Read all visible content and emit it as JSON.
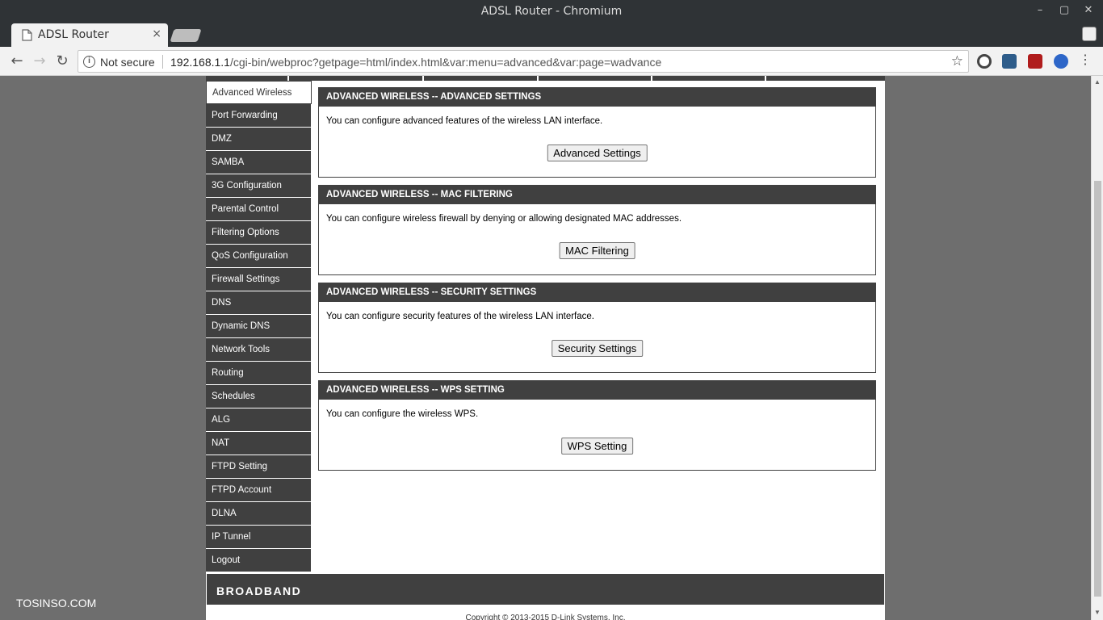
{
  "window": {
    "title": "ADSL Router - Chromium",
    "minimize": "–",
    "maximize": "▢",
    "close": "✕"
  },
  "tab": {
    "title": "ADSL Router",
    "close": "×"
  },
  "toolbar": {
    "back": "←",
    "forward": "→",
    "reload": "↻",
    "security_label": "Not secure",
    "url_host": "192.168.1.1",
    "url_path": "/cgi-bin/webproc?getpage=html/index.html&var:menu=advanced&var:page=wadvance",
    "bookmark": "☆",
    "menu": "⋮"
  },
  "sidebar": {
    "items": [
      {
        "label": "Advanced Wireless"
      },
      {
        "label": "Port Forwarding"
      },
      {
        "label": "DMZ"
      },
      {
        "label": "SAMBA"
      },
      {
        "label": "3G Configuration"
      },
      {
        "label": "Parental Control"
      },
      {
        "label": "Filtering Options"
      },
      {
        "label": "QoS Configuration"
      },
      {
        "label": "Firewall Settings"
      },
      {
        "label": "DNS"
      },
      {
        "label": "Dynamic DNS"
      },
      {
        "label": "Network Tools"
      },
      {
        "label": "Routing"
      },
      {
        "label": "Schedules"
      },
      {
        "label": "ALG"
      },
      {
        "label": "NAT"
      },
      {
        "label": "FTPD Setting"
      },
      {
        "label": "FTPD Account"
      },
      {
        "label": "DLNA"
      },
      {
        "label": "IP Tunnel"
      },
      {
        "label": "Logout"
      }
    ]
  },
  "panels": [
    {
      "heading": "ADVANCED WIRELESS -- ADVANCED SETTINGS",
      "text": "You can configure advanced features of the wireless LAN interface.",
      "button": "Advanced Settings"
    },
    {
      "heading": "ADVANCED WIRELESS -- MAC FILTERING",
      "text": "You can configure wireless firewall by denying or allowing designated MAC addresses.",
      "button": "MAC Filtering"
    },
    {
      "heading": "ADVANCED WIRELESS -- SECURITY SETTINGS",
      "text": "You can configure security features of the wireless LAN interface.",
      "button": "Security Settings"
    },
    {
      "heading": "ADVANCED WIRELESS -- WPS SETTING",
      "text": "You can configure the wireless WPS.",
      "button": "WPS Setting"
    }
  ],
  "footer": {
    "brand": "BROADBAND",
    "copyright": "Copyright © 2013-2015 D-Link Systems, Inc."
  },
  "watermark": "TOSINSO.COM",
  "colors": {
    "nav_dark": "#404040",
    "page_bg": "#6e6e6e"
  }
}
